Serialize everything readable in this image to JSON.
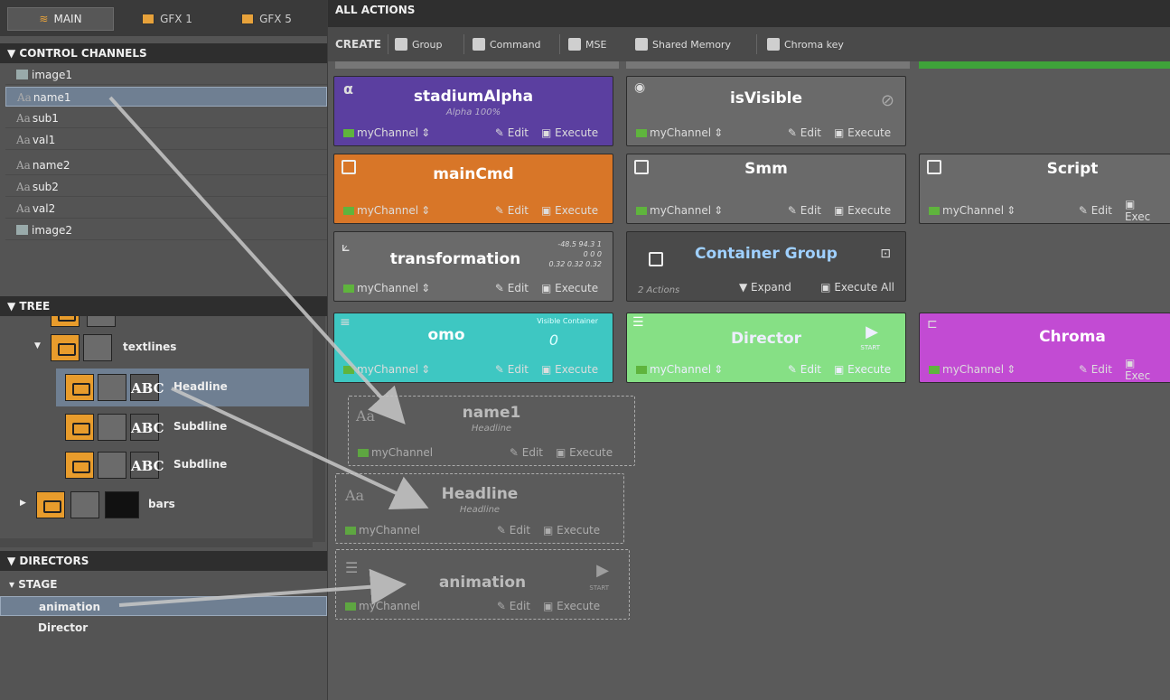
{
  "tabs": [
    {
      "label": "MAIN"
    },
    {
      "label": "GFX 1"
    },
    {
      "label": "GFX 5"
    }
  ],
  "control_channels": {
    "title": "▼ CONTROL CHANNELS",
    "items": [
      {
        "label": "image1",
        "type": "image"
      },
      {
        "label": "name1",
        "type": "text"
      },
      {
        "label": "sub1",
        "type": "text"
      },
      {
        "label": "val1",
        "type": "text"
      },
      {
        "label": "name2",
        "type": "text"
      },
      {
        "label": "sub2",
        "type": "text"
      },
      {
        "label": "val2",
        "type": "text"
      },
      {
        "label": "image2",
        "type": "image"
      }
    ]
  },
  "tree": {
    "title": "▼ TREE",
    "items": [
      {
        "label": "textlines"
      },
      {
        "label": "Headline",
        "badge": "Text",
        "abc": "ABC"
      },
      {
        "label": "Subdline",
        "badge": "Text",
        "abc": "ABC"
      },
      {
        "label": "Subdline",
        "badge": "Text",
        "abc": "ABC"
      },
      {
        "label": "bars"
      }
    ]
  },
  "directors": {
    "title": "▼ DIRECTORS",
    "stage": "▾ STAGE",
    "items": [
      {
        "label": "animation"
      },
      {
        "label": "Director"
      }
    ]
  },
  "all_actions": {
    "title": "ALL ACTIONS",
    "create": {
      "label": "CREATE",
      "buttons": [
        {
          "label": "Group"
        },
        {
          "label": "Command"
        },
        {
          "label": "MSE"
        },
        {
          "label": "Shared Memory"
        },
        {
          "label": "Chroma key"
        }
      ]
    }
  },
  "cards": {
    "stadiumAlpha": {
      "title": "stadiumAlpha",
      "sub": "Alpha 100%",
      "channel": "myChannel",
      "edit": "Edit",
      "exec": "Execute",
      "color": "#5b3fa0"
    },
    "isVisible": {
      "title": "isVisible",
      "channel": "myChannel",
      "edit": "Edit",
      "exec": "Execute",
      "color": "#6a6a6a"
    },
    "mainCmd": {
      "title": "mainCmd",
      "channel": "myChannel",
      "edit": "Edit",
      "exec": "Execute",
      "color": "#d87628"
    },
    "Smm": {
      "title": "Smm",
      "channel": "myChannel",
      "edit": "Edit",
      "exec": "Execute",
      "color": "#6a6a6a"
    },
    "Script": {
      "title": "Script",
      "channel": "myChannel",
      "edit": "Edit",
      "exec": "Exec",
      "color": "#6a6a6a"
    },
    "transformation": {
      "title": "transformation",
      "channel": "myChannel",
      "edit": "Edit",
      "exec": "Execute",
      "vals1": "-48.5 94.3 1",
      "vals2": "0 0 0",
      "vals3": "0.32 0.32 0.32",
      "color": "#6a6a6a"
    },
    "container": {
      "title": "Container Group",
      "actions": "2 Actions",
      "expand": "Expand",
      "exec": "Execute All",
      "color": "#4a4a4a"
    },
    "omo": {
      "title": "omo",
      "sub": "Visible Container",
      "val": "0",
      "channel": "myChannel",
      "edit": "Edit",
      "exec": "Execute",
      "color": "#3ec7c2"
    },
    "Director": {
      "title": "Director",
      "start": "START",
      "channel": "myChannel",
      "edit": "Edit",
      "exec": "Execute",
      "color": "#86e085"
    },
    "Chroma": {
      "title": "Chroma",
      "channel": "myChannel",
      "edit": "Edit",
      "exec": "Exec",
      "color": "#c24bd3"
    },
    "name1": {
      "title": "name1",
      "sub": "Headline",
      "channel": "myChannel",
      "edit": "Edit",
      "exec": "Execute"
    },
    "Headline": {
      "title": "Headline",
      "sub": "Headline",
      "channel": "myChannel",
      "edit": "Edit",
      "exec": "Execute"
    },
    "animation": {
      "title": "animation",
      "start": "START",
      "channel": "myChannel",
      "edit": "Edit",
      "exec": "Execute"
    }
  }
}
